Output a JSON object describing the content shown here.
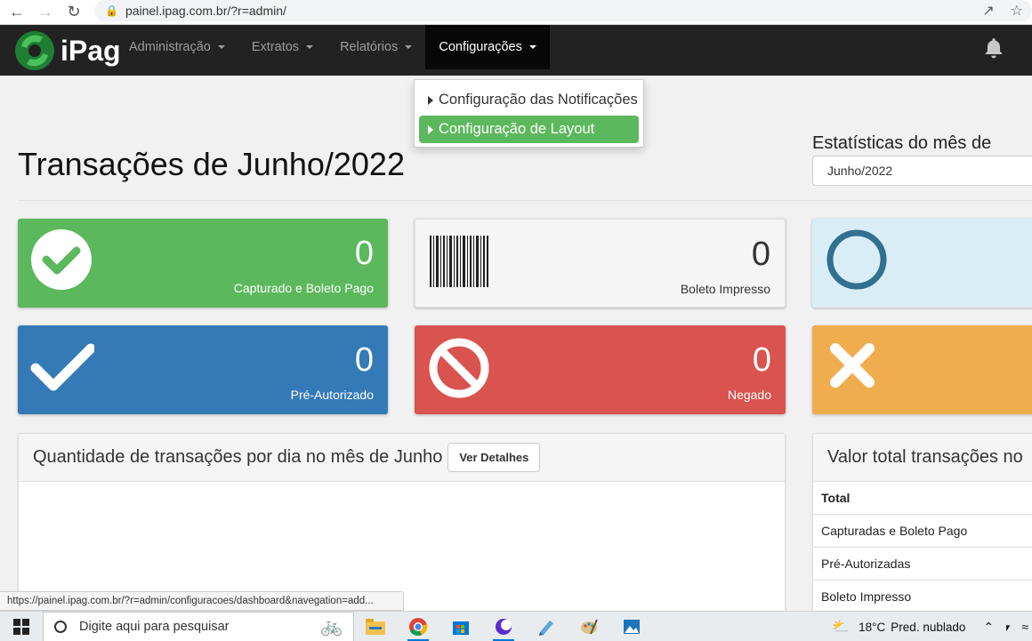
{
  "browser": {
    "url": "painel.ipag.com.br/?r=admin/",
    "back_icon": "arrow-left-icon",
    "forward_icon": "arrow-right-icon",
    "reload_icon": "reload-icon"
  },
  "app": {
    "logo_text": "iPag",
    "menu": [
      {
        "label": "Administração"
      },
      {
        "label": "Extratos"
      },
      {
        "label": "Relatórios"
      },
      {
        "label": "Configurações"
      }
    ],
    "dropdown": [
      {
        "label": "Configuração das Notificações"
      },
      {
        "label": "Configuração de Layout"
      }
    ]
  },
  "page": {
    "title": "Transações de Junho/2022",
    "stats_label": "Estatísticas do mês de",
    "month_selected": "Junho/2022"
  },
  "cards": [
    {
      "value": "0",
      "label": "Capturado e Boleto Pago",
      "color": "#5cb85c",
      "icon": "check-circle-icon"
    },
    {
      "value": "0",
      "label": "Boleto Impresso",
      "color": "#f5f5f5",
      "icon": "barcode-icon"
    },
    {
      "value": "",
      "label": "",
      "color": "#d9edf7",
      "icon": "circle-outline-icon"
    },
    {
      "value": "0",
      "label": "Pré-Autorizado",
      "color": "#337ab7",
      "icon": "check-icon"
    },
    {
      "value": "0",
      "label": "Negado",
      "color": "#d9534f",
      "icon": "ban-icon"
    },
    {
      "value": "",
      "label": "",
      "color": "#f0ad4e",
      "icon": "x-icon"
    }
  ],
  "panels": {
    "left_title": "Quantidade de transações por dia no mês de Junho",
    "details_button": "Ver Detalhes",
    "right_title": "Valor total transações no",
    "table_rows": [
      "Total",
      "Capturadas e Boleto Pago",
      "Pré-Autorizadas",
      "Boleto Impresso"
    ]
  },
  "status_url": "https://painel.ipag.com.br/?r=admin/configuracoes/dashboard&navegation=add...",
  "taskbar": {
    "search_placeholder": "Digite aqui para pesquisar",
    "temperature": "18°C",
    "weather": "Pred. nublado"
  }
}
